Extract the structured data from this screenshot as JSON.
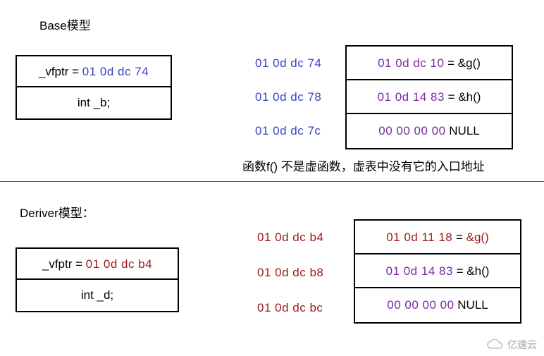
{
  "base": {
    "title": "Base模型",
    "obj": {
      "vfptr_label": "_vfptr = ",
      "vfptr_value": "01 0d dc 74",
      "member": "int _b;"
    },
    "addrs": [
      "01 0d dc 74",
      "01 0d dc 78",
      "01 0d dc 7c"
    ],
    "vtable": [
      {
        "val": "01 0d dc 10",
        "eq": " = ",
        "fn": "&g()"
      },
      {
        "val": "01 0d 14 83",
        "eq": " = ",
        "fn": "&h()"
      },
      {
        "val": "00 00 00 00",
        "eq": "  ",
        "fn": "NULL"
      }
    ],
    "note": "函数f() 不是虚函数，虚表中没有它的入口地址"
  },
  "deriver": {
    "title": "Deriver模型：",
    "obj": {
      "vfptr_label": "_vfptr = ",
      "vfptr_value": "01 0d dc b4",
      "member": "int _d;"
    },
    "addrs": [
      "01 0d dc b4",
      "01 0d dc b8",
      "01 0d dc bc"
    ],
    "vtable": [
      {
        "val": "01 0d 11 18",
        "eq": " = ",
        "fn": "&g()"
      },
      {
        "val": "01 0d 14 83",
        "eq": " = ",
        "fn": "&h()"
      },
      {
        "val": "00 00 00 00",
        "eq": "  ",
        "fn": "NULL"
      }
    ]
  },
  "watermark": "亿速云",
  "chart_data": {
    "type": "table",
    "description": "C++ object memory layout diagram showing vfptr and vtable for Base and Deriver classes",
    "classes": [
      {
        "name": "Base",
        "object_layout": [
          {
            "field": "_vfptr",
            "value": "01 0d dc 74"
          },
          {
            "field": "int _b"
          }
        ],
        "vtable": [
          {
            "address": "01 0d dc 74",
            "entry": "01 0d dc 10",
            "symbol": "&g()"
          },
          {
            "address": "01 0d dc 78",
            "entry": "01 0d 14 83",
            "symbol": "&h()"
          },
          {
            "address": "01 0d dc 7c",
            "entry": "00 00 00 00",
            "symbol": "NULL"
          }
        ],
        "note": "函数f() 不是虚函数，虚表中没有它的入口地址"
      },
      {
        "name": "Deriver",
        "object_layout": [
          {
            "field": "_vfptr",
            "value": "01 0d dc b4"
          },
          {
            "field": "int _d"
          }
        ],
        "vtable": [
          {
            "address": "01 0d dc b4",
            "entry": "01 0d 11 18",
            "symbol": "&g()"
          },
          {
            "address": "01 0d dc b8",
            "entry": "01 0d 14 83",
            "symbol": "&h()"
          },
          {
            "address": "01 0d dc bc",
            "entry": "00 00 00 00",
            "symbol": "NULL"
          }
        ]
      }
    ]
  }
}
